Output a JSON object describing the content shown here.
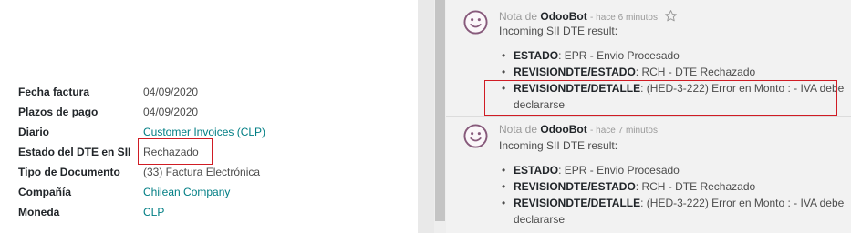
{
  "fields": [
    {
      "label": "Fecha factura",
      "value": "04/09/2020",
      "link": false
    },
    {
      "label": "Plazos de pago",
      "value": "04/09/2020",
      "link": false
    },
    {
      "label": "Diario",
      "value": "Customer Invoices (CLP)",
      "link": true
    },
    {
      "label": "Estado del DTE en SII",
      "value": "Rechazado",
      "link": false
    },
    {
      "label": "Tipo de Documento",
      "value": "(33) Factura Electrónica",
      "link": false
    },
    {
      "label": "Compañía",
      "value": "Chilean Company",
      "link": true
    },
    {
      "label": "Moneda",
      "value": "CLP",
      "link": true
    }
  ],
  "messages": [
    {
      "note_prefix": "Nota de",
      "author": "OdooBot",
      "time": "- hace 6 minutos",
      "intro": "Incoming SII DTE result:",
      "bullets": [
        {
          "key": "ESTADO",
          "text": ": EPR - Envio Procesado"
        },
        {
          "key": "REVISIONDTE/ESTADO",
          "text": ": RCH - DTE Rechazado"
        },
        {
          "key": "REVISIONDTE/DETALLE",
          "text": ": (HED-3-222) Error en Monto : - IVA debe declararse"
        }
      ]
    },
    {
      "note_prefix": "Nota de",
      "author": "OdooBot",
      "time": "- hace 7 minutos",
      "intro": "Incoming SII DTE result:",
      "bullets": [
        {
          "key": "ESTADO",
          "text": ": EPR - Envio Procesado"
        },
        {
          "key": "REVISIONDTE/ESTADO",
          "text": ": RCH - DTE Rechazado"
        },
        {
          "key": "REVISIONDTE/DETALLE",
          "text": ": (HED-3-222) Error en Monto : - IVA debe declararse"
        }
      ]
    }
  ],
  "colors": {
    "link": "#017e84",
    "highlight": "#d01c24",
    "avatar": "#875a7b"
  },
  "icons": {
    "avatar": "smiley-face-icon",
    "star": "star-outline-icon"
  }
}
